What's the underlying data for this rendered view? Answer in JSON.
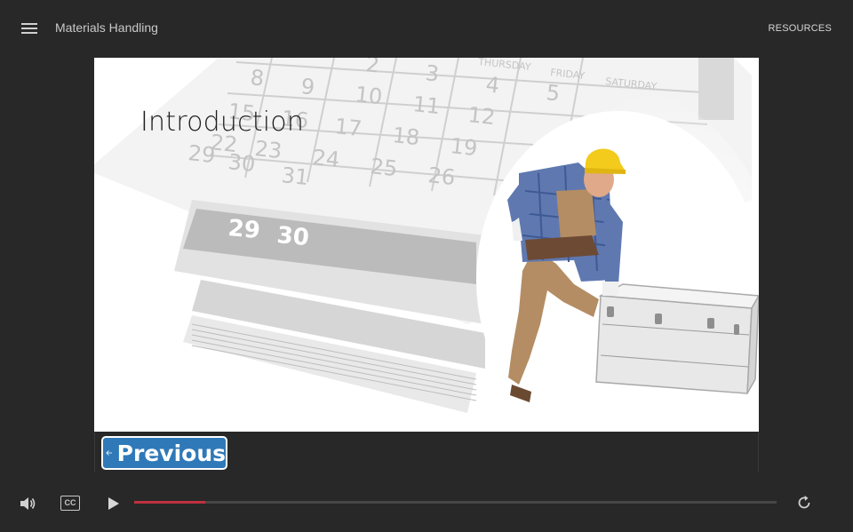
{
  "app": {
    "course_title": "Materials Handling",
    "resources_label": "RESOURCES"
  },
  "slide": {
    "title": "Introduction",
    "calendar_days": [
      "THURSDAY",
      "FRIDAY",
      "SATURDAY"
    ],
    "calendar_numbers": [
      "2",
      "3",
      "4",
      "5",
      "8",
      "9",
      "10",
      "11",
      "12",
      "15",
      "16",
      "17",
      "18",
      "19",
      "22",
      "23",
      "24",
      "25",
      "26",
      "29",
      "30",
      "31"
    ],
    "page_numbers": [
      "29",
      "30"
    ]
  },
  "navigation": {
    "previous_label": "Previous"
  },
  "player": {
    "cc_label": "CC",
    "progress": 0.11,
    "accent_color": "#c0313e",
    "button_color": "#2f79b8"
  }
}
